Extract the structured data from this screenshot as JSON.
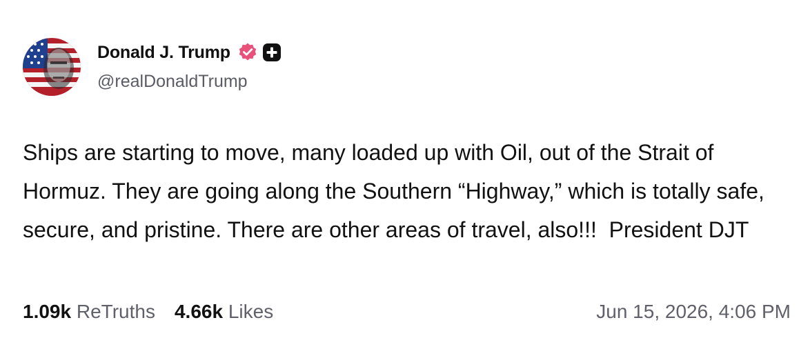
{
  "user": {
    "display_name": "Donald J. Trump",
    "handle": "@realDonaldTrump",
    "verified_icon": "verified-badge-icon",
    "plus_icon": "plus-badge-icon"
  },
  "post": {
    "text": "Ships are starting to move, many loaded up with Oil, out of the Strait of Hormuz. They are going along the Southern “Highway,” which is totally safe, secure, and pristine. There are other areas of travel, also!!!  President DJT"
  },
  "stats": {
    "retruths_count": "1.09k",
    "retruths_label": "ReTruths",
    "likes_count": "4.66k",
    "likes_label": "Likes"
  },
  "timestamp": "Jun 15, 2026, 4:06 PM",
  "colors": {
    "verified": "#e8527a",
    "text": "#111111",
    "muted": "#5b5b66",
    "background": "#ffffff"
  }
}
